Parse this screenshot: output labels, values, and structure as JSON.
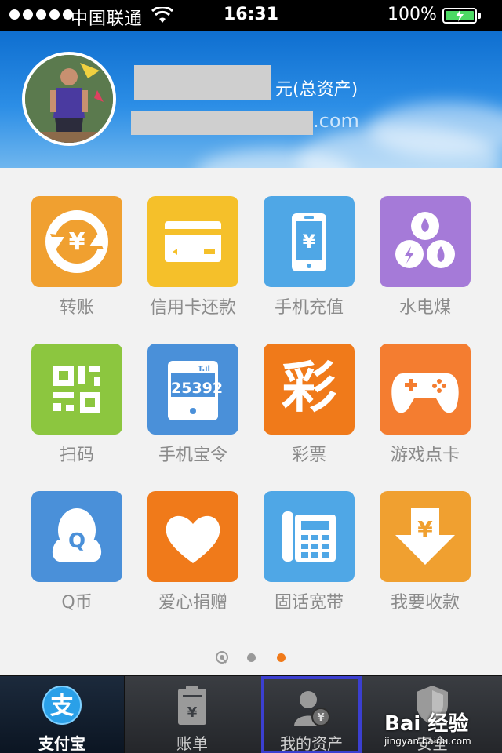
{
  "status_bar": {
    "carrier": "中国联通",
    "time": "16:31",
    "battery_percent": "100%",
    "battery_level": 1.0
  },
  "account": {
    "asset_label": "元(总资产)",
    "email_suffix": ".com"
  },
  "services": [
    {
      "label": "转账",
      "icon": "transfer-icon",
      "color": "#f0a030"
    },
    {
      "label": "信用卡还款",
      "icon": "credit-card-icon",
      "color": "#f5c02a"
    },
    {
      "label": "手机充值",
      "icon": "phone-recharge-icon",
      "color": "#4fa7e6"
    },
    {
      "label": "水电煤",
      "icon": "utilities-icon",
      "color": "#a57ad8"
    },
    {
      "label": "扫码",
      "icon": "qr-code-icon",
      "color": "#8cc63f"
    },
    {
      "label": "手机宝令",
      "icon": "token-icon",
      "color": "#4a90d9",
      "token_code": "25392"
    },
    {
      "label": "彩票",
      "icon": "lottery-icon",
      "color": "#f07a1a",
      "glyph": "彩"
    },
    {
      "label": "游戏点卡",
      "icon": "gamepad-icon",
      "color": "#f47d30"
    },
    {
      "label": "Q币",
      "icon": "qq-coin-icon",
      "color": "#4a90d9"
    },
    {
      "label": "爱心捐赠",
      "icon": "heart-icon",
      "color": "#f07a1a"
    },
    {
      "label": "固话宽带",
      "icon": "landline-icon",
      "color": "#4fa7e6"
    },
    {
      "label": "我要收款",
      "icon": "receive-money-icon",
      "color": "#f0a030"
    }
  ],
  "pager": {
    "pages": 2,
    "current": 2,
    "active_color": "#f07a1a",
    "inactive_color": "#999999"
  },
  "tabs": [
    {
      "label": "支付宝",
      "icon": "alipay-icon",
      "active": true
    },
    {
      "label": "账单",
      "icon": "bill-icon",
      "active": false
    },
    {
      "label": "我的资产",
      "icon": "my-assets-icon",
      "active": false
    },
    {
      "label": "安全",
      "icon": "security-icon",
      "active": false
    }
  ],
  "watermark": {
    "main": "Bai 经验",
    "sub": "jingyan.baidu.com"
  }
}
